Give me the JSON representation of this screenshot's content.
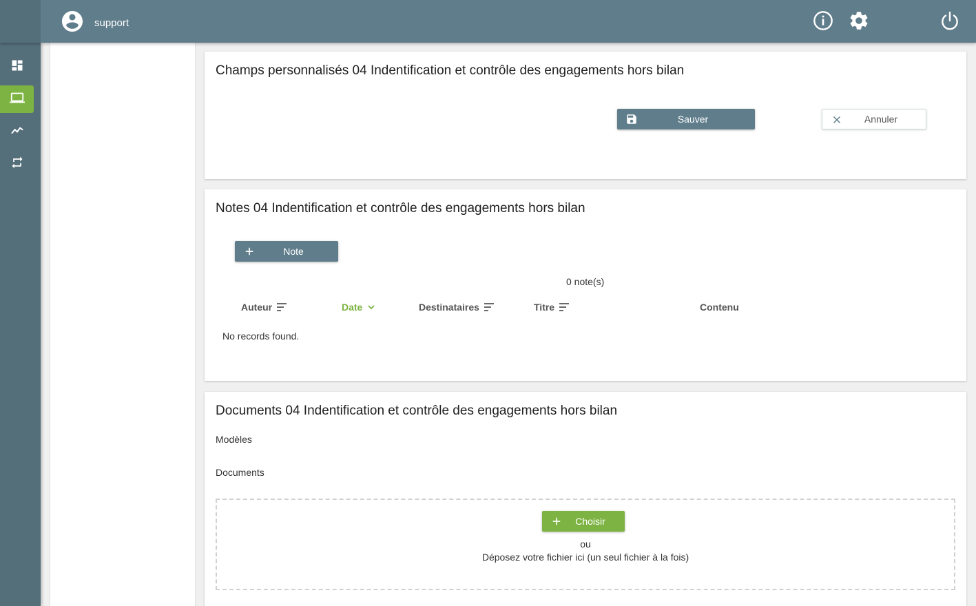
{
  "header": {
    "username": "support",
    "icons": [
      "info-icon",
      "gear-icon",
      "power-icon"
    ]
  },
  "sidebar": {
    "items": [
      {
        "icon": "dashboard-icon",
        "active": false
      },
      {
        "icon": "laptop-icon",
        "active": true
      },
      {
        "icon": "trending-icon",
        "active": false
      },
      {
        "icon": "swap-icon",
        "active": false
      }
    ]
  },
  "custom_fields": {
    "title": "Champs personnalisés 04 Indentification et contrôle des engagements hors bilan",
    "save_label": "Sauver",
    "cancel_label": "Annuler"
  },
  "notes": {
    "title": "Notes 04 Indentification et contrôle des engagements hors bilan",
    "add_label": "Note",
    "count": "0 note(s)",
    "columns": [
      {
        "label": "Auteur",
        "sort": "none"
      },
      {
        "label": "Date",
        "sort": "desc"
      },
      {
        "label": "Destinataires",
        "sort": "none"
      },
      {
        "label": "Titre",
        "sort": "none"
      },
      {
        "label": "Contenu",
        "sort": "disabled"
      }
    ],
    "empty": "No records found."
  },
  "documents": {
    "title": "Documents 04 Indentification et contrôle des engagements hors bilan",
    "templates_label": "Modèles",
    "documents_label": "Documents",
    "choose_label": "Choisir",
    "or": "ou",
    "drop_hint": "Déposez votre fichier ici (un seul fichier à la fois)"
  },
  "colors": {
    "header": "#607d8b",
    "sidebar": "#546e7a",
    "accent": "#7cb342"
  }
}
